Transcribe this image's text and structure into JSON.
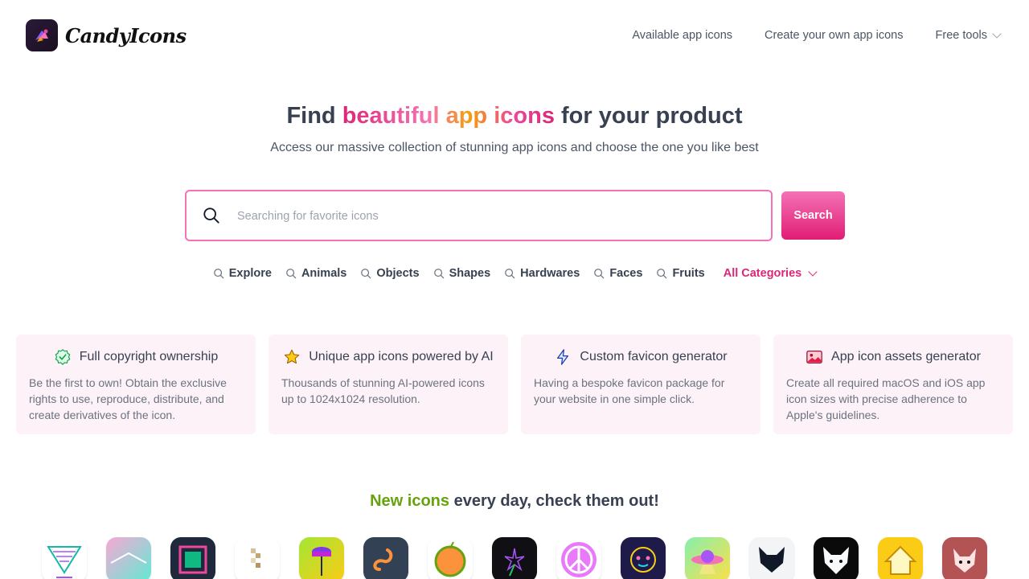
{
  "brand": {
    "name": "CandyIcons"
  },
  "nav": {
    "available": "Available app icons",
    "create": "Create your own app icons",
    "free_tools": "Free tools"
  },
  "hero": {
    "title_pre": "Find ",
    "title_highlight": "beautiful app icons",
    "title_post": " for your product",
    "subtitle": "Access our massive collection of stunning app icons and choose the one you like best"
  },
  "search": {
    "placeholder": "Searching for favorite icons",
    "button": "Search"
  },
  "categories": [
    "Explore",
    "Animals",
    "Objects",
    "Shapes",
    "Hardwares",
    "Faces",
    "Fruits"
  ],
  "all_categories": "All Categories",
  "features": [
    {
      "icon": "shield-check-icon",
      "title": "Full copyright ownership",
      "body": "Be the first to own! Obtain the exclusive rights to use, reproduce, distribute, and create derivatives of the icon."
    },
    {
      "icon": "star-icon",
      "title": "Unique app icons powered by AI",
      "body": "Thousands of stunning AI-powered icons up to 1024x1024 resolution."
    },
    {
      "icon": "lightning-icon",
      "title": "Custom favicon generator",
      "body": "Having a bespoke favicon package for your website in one simple click."
    },
    {
      "icon": "image-icon",
      "title": "App icon assets generator",
      "body": "Create all required macOS and iOS app icon sizes with precise adherence to Apple's guidelines."
    }
  ],
  "new_icons": {
    "highlight": "New icons",
    "rest": " every day, check them out!"
  },
  "colors": {
    "accent": "#db2777",
    "search_border": "#f472b6",
    "feature_bg": "#fdf2f8",
    "green": "#65a30d"
  }
}
